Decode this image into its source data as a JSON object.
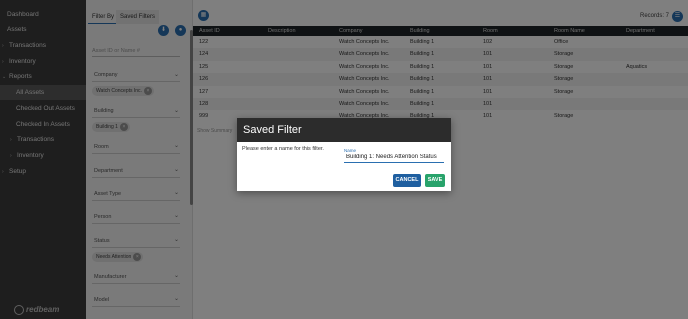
{
  "sidebar": {
    "items": [
      {
        "label": "Dashboard",
        "arrow": ""
      },
      {
        "label": "Assets",
        "arrow": ""
      },
      {
        "label": "Transactions",
        "arrow": "›"
      },
      {
        "label": "Inventory",
        "arrow": "›"
      },
      {
        "label": "Reports",
        "arrow": "⌄"
      },
      {
        "label": "All Assets",
        "arrow": ""
      },
      {
        "label": "Checked Out Assets",
        "arrow": ""
      },
      {
        "label": "Checked In Assets",
        "arrow": ""
      },
      {
        "label": "Transactions",
        "arrow": "›"
      },
      {
        "label": "Inventory",
        "arrow": "›"
      },
      {
        "label": "Setup",
        "arrow": "›"
      }
    ],
    "logo": "redbeam"
  },
  "filter_panel": {
    "tabs": [
      "Filter By",
      "Saved Filters"
    ],
    "search_placeholder": "Asset ID or Name #",
    "filters": [
      {
        "label": "Company",
        "chip": "Watch Concepts Inc."
      },
      {
        "label": "Building",
        "chip": "Building 1"
      },
      {
        "label": "Room",
        "chip": null
      },
      {
        "label": "Department",
        "chip": null
      },
      {
        "label": "Asset Type",
        "chip": null
      },
      {
        "label": "Person",
        "chip": null
      },
      {
        "label": "Status",
        "chip": "Needs Attention"
      },
      {
        "label": "Manufacturer",
        "chip": null
      },
      {
        "label": "Model",
        "chip": null
      }
    ]
  },
  "main": {
    "records_label": "Records: 7",
    "columns": [
      "Asset ID",
      "Description",
      "Company",
      "Building",
      "Room",
      "Room Name",
      "Department"
    ],
    "rows": [
      [
        "122",
        "",
        "Watch Concepts Inc.",
        "Building 1",
        "102",
        "Office",
        ""
      ],
      [
        "124",
        "",
        "Watch Concepts Inc.",
        "Building 1",
        "101",
        "Storage",
        ""
      ],
      [
        "125",
        "",
        "Watch Concepts Inc.",
        "Building 1",
        "101",
        "Storage",
        "Aquatics"
      ],
      [
        "126",
        "",
        "Watch Concepts Inc.",
        "Building 1",
        "101",
        "Storage",
        ""
      ],
      [
        "127",
        "",
        "Watch Concepts Inc.",
        "Building 1",
        "101",
        "Storage",
        ""
      ],
      [
        "128",
        "",
        "Watch Concepts Inc.",
        "Building 1",
        "101",
        "",
        ""
      ],
      [
        "999",
        "",
        "Watch Concepts Inc.",
        "Building 1",
        "101",
        "Storage",
        ""
      ]
    ],
    "more_link": "Show Summary"
  },
  "dialog": {
    "title": "Saved Filter",
    "prompt": "Please enter a name for this filter.",
    "name_label": "Name",
    "name_value": "Building 1: Needs Attention Status",
    "cancel_label": "CANCEL",
    "save_label": "SAVE"
  },
  "colors": {
    "accent": "#2a6fb0",
    "save": "#28a36b",
    "cancel": "#1f5fa0",
    "sidebar": "#3c3c3c",
    "header": "#1e2428"
  }
}
